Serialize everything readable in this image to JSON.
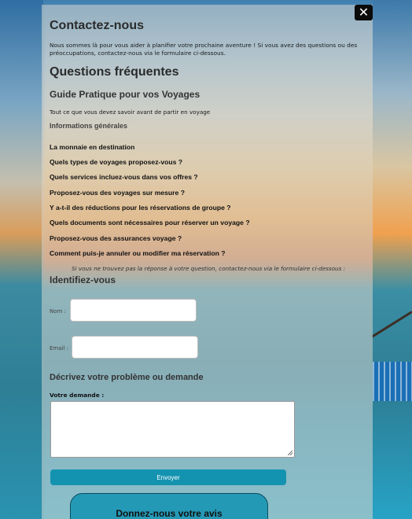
{
  "modal": {
    "close_label": "✕",
    "title": "Contactez-nous",
    "intro": "Nous sommes là pour vous aider à planifier votre prochaine aventure ! Si vous avez des questions ou des préoccupations, contactez-nous via le formulaire ci-dessous.",
    "faq_title": "Questions fréquentes",
    "guide_title": "Guide Pratique pour vos Voyages",
    "guide_subtitle": "Tout ce que vous devez savoir avant de partir en voyage",
    "general_info": "Informations générales",
    "faq_items": [
      "La monnaie en destination",
      "Quels types de voyages proposez-vous ?",
      "Quels services incluez-vous dans vos offres ?",
      "Proposez-vous des voyages sur mesure ?",
      "Y a-t-il des réductions pour les réservations de groupe ?",
      "Quels documents sont nécessaires pour réserver un voyage ?",
      "Proposez-vous des assurances voyage ?",
      "Comment puis-je annuler ou modifier ma réservation ?"
    ],
    "note": "Si vous ne trouvez pas la réponse à votre question, contactez-nous via le formulaire ci-dessous :",
    "identify_title": "Identifiez-vous",
    "name_label": "Nom :",
    "email_label": "Email :",
    "describe_title": "Décrivez votre problème ou demande",
    "request_label": "Votre demande :",
    "submit_label": "Envoyer",
    "review_label": "Donnez-nous votre avis"
  },
  "colors": {
    "accent": "#1493b0",
    "review_button": "#2499b6",
    "close_button": "#0b0b0b"
  }
}
